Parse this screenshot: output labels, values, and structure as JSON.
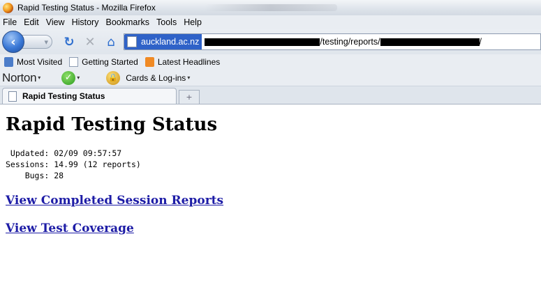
{
  "window": {
    "title": "Rapid Testing Status - Mozilla Firefox"
  },
  "menu": [
    "File",
    "Edit",
    "View",
    "History",
    "Bookmarks",
    "Tools",
    "Help"
  ],
  "url": {
    "domain": "auckland.ac.nz",
    "path_visible": "/testing/reports/"
  },
  "bookmarks": [
    "Most Visited",
    "Getting Started",
    "Latest Headlines"
  ],
  "norton": {
    "logo": "Norton",
    "cards_label": "Cards & Log-ins"
  },
  "tab": {
    "label": "Rapid Testing Status",
    "new_tab": "+"
  },
  "page": {
    "heading": "Rapid Testing Status",
    "updated": " Updated: 02/09 09:57:57",
    "sessions": "Sessions: 14.99 (12 reports)",
    "bugs": "    Bugs: 28",
    "link_reports": "View Completed Session Reports",
    "link_coverage": "View Test Coverage"
  }
}
